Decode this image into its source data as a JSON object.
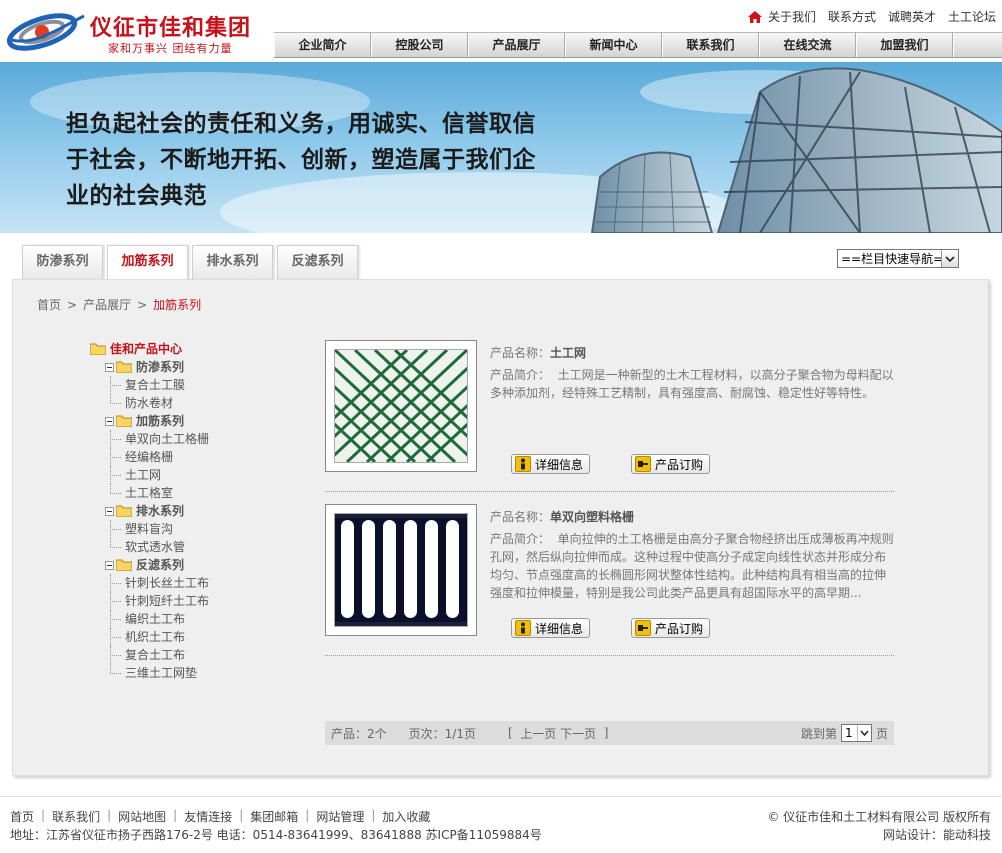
{
  "header": {
    "brand_name": "仪征市佳和集团",
    "brand_slogan": "家和万事兴  团结有力量",
    "top_links": [
      "关于我们",
      "联系方式",
      "诚聘英才",
      "土工论坛"
    ],
    "nav": [
      "企业简介",
      "控股公司",
      "产品展厅",
      "新闻中心",
      "联系我们",
      "在线交流",
      "加盟我们"
    ]
  },
  "banner": {
    "slogan": "担负起社会的责任和义务，用诚实、信誉取信于社会，不断地开拓、创新，塑造属于我们企业的社会典范"
  },
  "tabs": [
    {
      "label": "防渗系列",
      "active": false
    },
    {
      "label": "加筋系列",
      "active": true
    },
    {
      "label": "排水系列",
      "active": false
    },
    {
      "label": "反滤系列",
      "active": false
    }
  ],
  "quick_nav": {
    "selected": "==栏目快速导航=="
  },
  "breadcrumb": {
    "items": [
      "首页",
      "产品展厅"
    ],
    "current": "加筋系列"
  },
  "tree": {
    "root": "佳和产品中心",
    "categories": [
      {
        "label": "防渗系列",
        "items": [
          "复合土工膜",
          "防水卷材"
        ]
      },
      {
        "label": "加筋系列",
        "items": [
          "单双向土工格栅",
          "经编格栅",
          "土工网",
          "土工格室"
        ]
      },
      {
        "label": "排水系列",
        "items": [
          "塑料盲沟",
          "软式透水管"
        ]
      },
      {
        "label": "反滤系列",
        "items": [
          "针刺长丝土工布",
          "针刺短纤土工布",
          "编织土工布",
          "机织土工布",
          "复合土工布",
          "三维土工网垫"
        ]
      }
    ]
  },
  "product_labels": {
    "name_label": "产品名称：",
    "intro_label": "产品简介：",
    "detail_button": "详细信息",
    "order_button": "产品订购"
  },
  "products": [
    {
      "name": "土工网",
      "intro": "土工网是一种新型的土木工程材料，以高分子聚合物为母料配以多种添加剂，经特殊工艺精制，具有强度高、耐腐蚀、稳定性好等特性。"
    },
    {
      "name": "单双向塑料格栅",
      "intro": "单向拉伸的土工格栅是由高分子聚合物经挤出压成薄板再冲规则孔网，然后纵向拉伸而成。这种过程中使高分子成定向线性状态并形成分布均匀、节点强度高的长椭圆形网状整体性结构。此种结构具有相当高的拉伸强度和拉伸模量，特别是我公司此类产品更具有超国际水平的高早期..."
    }
  ],
  "pager": {
    "count_text": "产品：2个",
    "page_text": "页次：1/1页",
    "prev": "上一页",
    "next": "下一页",
    "jump_label": "跳到第",
    "page_value": "1",
    "page_suffix": "页"
  },
  "footer": {
    "links": [
      "首页",
      "联系我们",
      "网站地图",
      "友情连接",
      "集团邮箱",
      "网站管理",
      "加入收藏"
    ],
    "address": "地址：江苏省仪征市扬子西路176-2号   电话：0514-83641999、83641888   苏ICP备11059884号",
    "copyright": "© 仪征市佳和土工材料有限公司 版权所有",
    "design": "网站设计：能动科技"
  },
  "colors": {
    "accent": "#c8101a",
    "panel": "#efefef",
    "nav_grad": "#d4d4d4"
  }
}
